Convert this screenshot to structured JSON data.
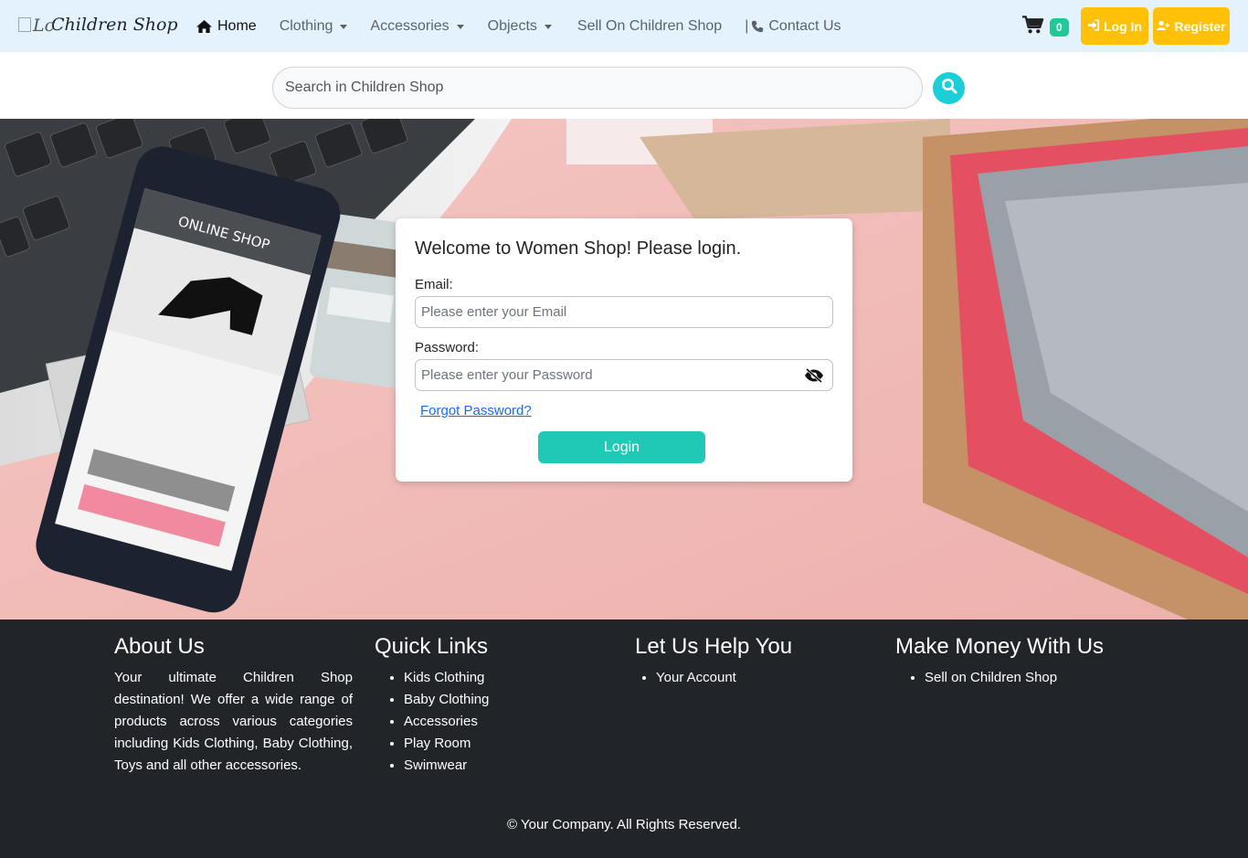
{
  "brand": {
    "alt_text": "Lc",
    "name": "Children Shop"
  },
  "nav": {
    "home": "Home",
    "clothing": "Clothing",
    "accessories": "Accessories",
    "objects": "Objects",
    "sell": "Sell On Children Shop",
    "contact_prefix": "|",
    "contact": "Contact Us"
  },
  "cart": {
    "count": "0",
    "icon": "cart-icon"
  },
  "auth": {
    "login": "Log In",
    "register": "Register"
  },
  "search": {
    "placeholder": "Search in Children Shop",
    "icon": "search-icon"
  },
  "login_form": {
    "title": "Welcome to Women Shop! Please login.",
    "email_label": "Email:",
    "email_placeholder": "Please enter your Email",
    "password_label": "Password:",
    "password_placeholder": "Please enter your Password",
    "forgot": "Forgot Password?",
    "submit": "Login"
  },
  "footer": {
    "about": {
      "title": "About Us",
      "text": "Your ultimate Children Shop destination! We offer a wide range of products across various categories including Kids Clothing, Baby Clothing, Toys and all other accessories."
    },
    "quick_links": {
      "title": "Quick Links",
      "items": [
        "Kids Clothing",
        "Baby Clothing",
        "Accessories",
        "Play Room",
        "Swimwear"
      ]
    },
    "help": {
      "title": "Let Us Help You",
      "items": [
        "Your Account"
      ]
    },
    "money": {
      "title": "Make Money With Us",
      "items": [
        "Sell on Children Shop"
      ]
    },
    "copyright": "© Your Company. All Rights Reserved."
  },
  "colors": {
    "navbar": "#e3f2fd",
    "accent_yellow": "#ffc107",
    "accent_teal": "#20c9b5",
    "footer": "#212529"
  }
}
